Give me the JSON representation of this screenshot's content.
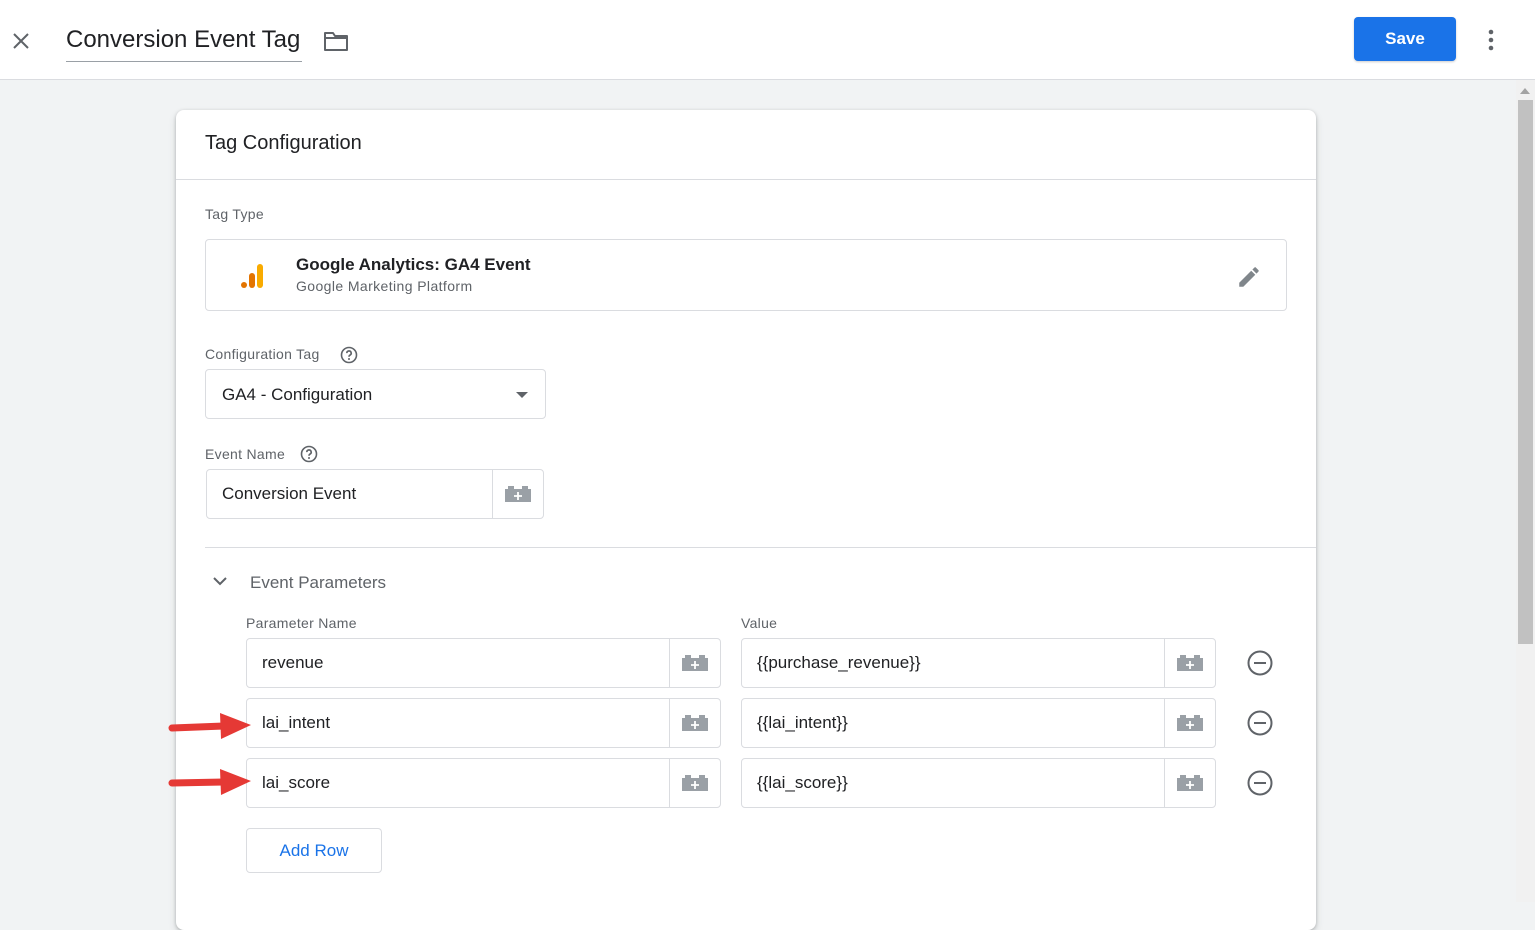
{
  "header": {
    "title": "Conversion Event Tag",
    "save_label": "Save",
    "icons": [
      "close-icon",
      "folder-icon",
      "more-vert-icon"
    ]
  },
  "card": {
    "title": "Tag Configuration",
    "tag_type": {
      "label": "Tag Type",
      "name": "Google Analytics: GA4 Event",
      "provider": "Google Marketing Platform",
      "icons": [
        "ga-logo-icon",
        "edit-icon"
      ]
    },
    "configuration_tag": {
      "label": "Configuration Tag",
      "value": "GA4 - Configuration"
    },
    "event_name": {
      "label": "Event Name",
      "value": "Conversion Event"
    },
    "event_parameters": {
      "title": "Event Parameters",
      "column_name": "Parameter Name",
      "column_value": "Value",
      "rows": [
        {
          "name": "revenue",
          "value": "{{purchase_revenue}}",
          "highlighted": false
        },
        {
          "name": "lai_intent",
          "value": "{{lai_intent}}",
          "highlighted": true
        },
        {
          "name": "lai_score",
          "value": "{{lai_score}}",
          "highlighted": true
        }
      ],
      "add_row_label": "Add Row"
    }
  },
  "colors": {
    "accent": "#1a73e8",
    "annotation_arrow": "#e53935",
    "ga_orange": "#f9ab00",
    "ga_dark_orange": "#e37400"
  }
}
